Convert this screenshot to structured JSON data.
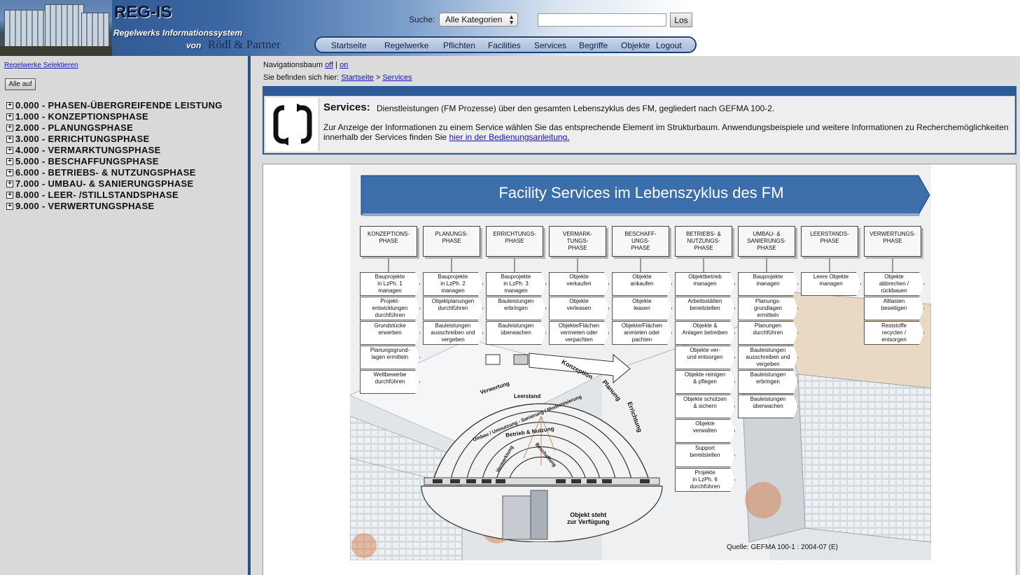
{
  "header": {
    "logo_title": "REG-IS",
    "logo_subtitle": "Regelwerks Informationssystem",
    "logo_von": "von",
    "logo_partner": "Rödl & Partner",
    "search_label": "Suche:",
    "search_category": "Alle Kategorien",
    "search_value": "",
    "search_button": "Los",
    "nav": [
      "Startseite",
      "Regelwerke",
      "Pflichten",
      "Facilities",
      "Services",
      "Begriffe",
      "Objekte",
      "Logout"
    ]
  },
  "sidebar": {
    "select_link": "Regelwerke Selektieren",
    "open_all_button": "Alle auf",
    "tree": [
      "0.000 - PHASEN-ÜBERGREIFENDE LEISTUNG",
      "1.000 - KONZEPTIONSPHASE",
      "2.000 - PLANUNGSPHASE",
      "3.000 - ERRICHTUNGSPHASE",
      "4.000 - VERMARKTUNGSPHASE",
      "5.000 - BESCHAFFUNGSPHASE",
      "6.000 - BETRIEBS- & NUTZUNGSPHASE",
      "7.000 - UMBAU- & SANIERUNGSPHASE",
      "8.000 - LEER- /STILLSTANDSPHASE",
      "9.000 - VERWERTUNGSPHASE"
    ]
  },
  "main": {
    "navtree_label": "Navigationsbaum",
    "navtree_off": "off",
    "navtree_sep": "|",
    "navtree_on": "on",
    "breadcrumb_prefix": "Sie befinden sich hier:",
    "breadcrumb_home": "Startseite",
    "breadcrumb_sep": ">",
    "breadcrumb_current": "Services",
    "info_heading": "Services:",
    "info_desc": "Dienstleistungen (FM Prozesse) über den gesamten Lebenszyklus des FM, gegliedert nach GEFMA 100-2.",
    "info_text": "Zur Anzeige der Informationen zu einem Service wählen Sie das entsprechende Element im Strukturbaum. Anwendungsbeispiele und weitere Informationen zu Recherchemöglichkeiten innerhalb der Services finden Sie",
    "info_link": "hier in der Bedienungsanleitung."
  },
  "diagram": {
    "title": "Facility Services im Lebenszyklus des FM",
    "source": "Quelle: GEFMA 100-1 : 2004-07 (E)",
    "center_label_1": "Objekt steht",
    "center_label_2": "zur Verfügung",
    "phases": [
      {
        "name": "KONZEPTIONS-\nPHASE",
        "tasks": [
          "Bauprojekte\nin LzPh. 1\nmanagen",
          "Projekt-\nentwicklungen\ndurchführen",
          "Grundstücke\nerwerben",
          "Planungsgrund-\nlagen ermitteln",
          "Wettbewerbe\ndurchführen"
        ]
      },
      {
        "name": "PLANUNGS-\nPHASE",
        "tasks": [
          "Bauprojekte\nin LzPh. 2\nmanagen",
          "Objektplanungen\ndurchführen",
          "Bauleistungen\nausschreiben und\nvergeben"
        ]
      },
      {
        "name": "ERRICHTUNGS-\nPHASE",
        "tasks": [
          "Bauprojekte\nin LzPh. 3\nmanagen",
          "Bauleistungen\nerbringen",
          "Bauleistungen\nüberwachen"
        ]
      },
      {
        "name": "VERMARK-\nTUNGS-\nPHASE",
        "tasks": [
          "Objekte\nverkaufen",
          "Objekte\nverleasen",
          "Objekte/Flächen\nvermieten oder\nverpachten"
        ]
      },
      {
        "name": "BESCHAFF-\nUNGS-\nPHASE",
        "tasks": [
          "Objekte\nankaufen",
          "Objekte\nleasen",
          "Objekte/Flächen\nanmieten oder\npachten"
        ]
      },
      {
        "name": "BETRIEBS- &\nNUTZUNGS-\nPHASE",
        "tasks": [
          "Objektbetrieb\nmanagen",
          "Arbeitsstätten\nbereitstellen",
          "Objekte &\nAnlagen betreiben",
          "Objekte ver-\nund entsorgen",
          "Objekte reinigen\n& pflegen",
          "Objekte schützen\n& sichern",
          "Objekte\nverwalten",
          "Support\nbereitstellen",
          "Projekte\nin LzPh. 6\ndurchführen"
        ]
      },
      {
        "name": "UMBAU- &\nSANIERUNGS-\nPHASE",
        "tasks": [
          "Bauprojekte\nmanagen",
          "Planungs-\ngrundlagen\nermitteln",
          "Planungen\ndurchführen",
          "Bauleistungen\nausschreiben und\nvergeben",
          "Bauleistungen\nerbringen",
          "Bauleistungen\nüberwachen"
        ]
      },
      {
        "name": "LEERSTANDS-\nPHASE",
        "tasks": [
          "Leere Objekte\nmanagen"
        ]
      },
      {
        "name": "VERWERTUNGS-\nPHASE",
        "tasks": [
          "Objekte\nabbrechen /\nrückbauen",
          "Altlasten\nbeseitigen",
          "Reststoffe\nrecyclen /\nentsorgen"
        ]
      }
    ],
    "arc_labels": [
      "Verwertung",
      "Leerstand",
      "Umbau / Umnutzung - Sanierung / Modernisierung",
      "Betrieb & Nutzung",
      "Vermarktung",
      "Beschaffung",
      "Konzeption",
      "Planung",
      "Errichtung"
    ]
  }
}
